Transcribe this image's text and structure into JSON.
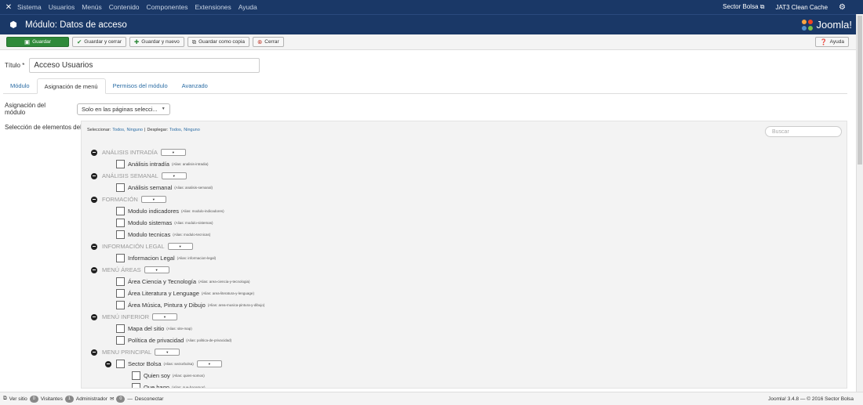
{
  "navbar": {
    "menu": [
      "Sistema",
      "Usuarios",
      "Menús",
      "Contenido",
      "Componentes",
      "Extensiones",
      "Ayuda"
    ],
    "site_link": "Sector Bolsa",
    "cache": "JAT3 Clean Cache"
  },
  "titlebar": {
    "title": "Módulo: Datos de acceso",
    "logo": "Joomla!"
  },
  "toolbar": {
    "save": "Guardar",
    "save_close": "Guardar y cerrar",
    "save_new": "Guardar y nuevo",
    "save_copy": "Guardar como copia",
    "close": "Cerrar",
    "help": "Ayuda"
  },
  "form": {
    "title_label": "Título *",
    "title_value": "Acceso Usuarios",
    "tabs": [
      "Módulo",
      "Asignación de menú",
      "Permisos del módulo",
      "Avanzado"
    ],
    "assign_label": "Asignación del módulo",
    "assign_value": "Solo en las páginas selecci...",
    "selection_label": "Selección de elementos del menú:",
    "select_label": "Seleccionar:",
    "select_all": "Todos,",
    "select_none": "Ninguno",
    "sep": "|",
    "expand_label": "Desplegar:",
    "expand_all": "Todos,",
    "expand_none": "Ninguno",
    "search_placeholder": "Buscar"
  },
  "menu_tree": {
    "groups": [
      {
        "name": "ANÁLISIS INTRADÍA",
        "items": [
          {
            "name": "Análisis intradía",
            "alias": "(Alias: analisis-intradia)"
          }
        ]
      },
      {
        "name": "ANÁLISIS SEMANAL",
        "items": [
          {
            "name": "Análisis semanal",
            "alias": "(Alias: analisis-semanal)"
          }
        ]
      },
      {
        "name": "FORMACIÓN",
        "items": [
          {
            "name": "Modulo indicadores",
            "alias": "(Alias: modulo-indicadores)"
          },
          {
            "name": "Modulo sistemas",
            "alias": "(Alias: modulo-sistemas)"
          },
          {
            "name": "Modulo tecnicas",
            "alias": "(Alias: modulo-tecnicas)"
          }
        ]
      },
      {
        "name": "INFORMACIÓN LEGAL",
        "items": [
          {
            "name": "Informacion Legal",
            "alias": "(Alias: informacion-legal)"
          }
        ]
      },
      {
        "name": "MENÚ ÁREAS",
        "items": [
          {
            "name": "Área Ciencia y Tecnología",
            "alias": "(Alias: area-ciencia-y-tecnologia)"
          },
          {
            "name": "Área Literatura y Lenguage",
            "alias": "(Alias: area-literatura-y-lenguage)"
          },
          {
            "name": "Área Música, Pintura y Dibujo",
            "alias": "(Alias: area-musica-pintura-y-dibujo)"
          }
        ]
      },
      {
        "name": "MENÚ INFERIOR",
        "items": [
          {
            "name": "Mapa del sitio",
            "alias": "(Alias: site-map)"
          },
          {
            "name": "Política de privacidad",
            "alias": "(Alias: politica-de-privacidad)"
          }
        ]
      },
      {
        "name": "MENU PRINCIPAL",
        "items": []
      }
    ],
    "sub": {
      "name": "Sector Bolsa",
      "alias": "(Alias: sectorbolsa)",
      "children": [
        {
          "name": "Quien soy",
          "alias": "(Alias: quien-somos)"
        },
        {
          "name": "Que hago",
          "alias": "(Alias: que-hacemos)"
        }
      ]
    }
  },
  "status": {
    "view_site": "Ver sitio",
    "visitors_count": "0",
    "visitors": "Visitantes",
    "admin_count": "1",
    "admin": "Administrador",
    "msg_count": "0",
    "logout": "Desconectar",
    "version": "Joomla! 3.4.8 — © 2016 Sector Bolsa"
  },
  "colors": {
    "navbar": "#1a3867",
    "save": "#2f8a3a",
    "link": "#2a6ca4"
  }
}
